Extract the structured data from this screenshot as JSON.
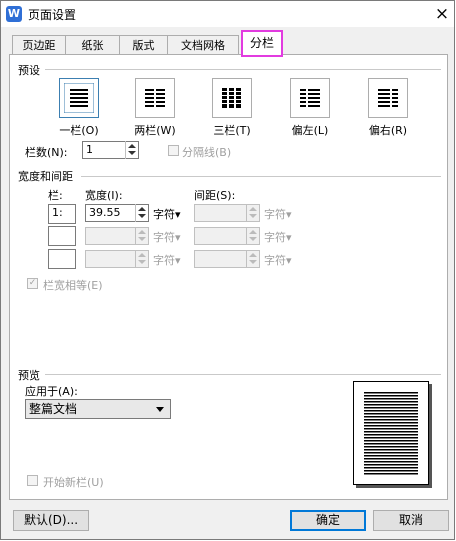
{
  "window": {
    "icon_letter": "W",
    "title": "页面设置",
    "close_symbol": "×"
  },
  "tabs": [
    {
      "label": "页边距"
    },
    {
      "label": "纸张"
    },
    {
      "label": "版式"
    },
    {
      "label": "文档网格"
    },
    {
      "label": "分栏",
      "active": true
    }
  ],
  "presets": {
    "section_label": "预设",
    "items": [
      {
        "label": "一栏(O)",
        "icon": "one-column-icon",
        "selected": true
      },
      {
        "label": "两栏(W)",
        "icon": "two-columns-icon"
      },
      {
        "label": "三栏(T)",
        "icon": "three-columns-icon"
      },
      {
        "label": "偏左(L)",
        "icon": "left-column-icon"
      },
      {
        "label": "偏右(R)",
        "icon": "right-column-icon"
      }
    ]
  },
  "column_count": {
    "label": "栏数(N):",
    "value": "1"
  },
  "divider_line": {
    "label": "分隔线(B)",
    "checked": false,
    "enabled": false
  },
  "width_spacing": {
    "section_label": "宽度和间距",
    "col_header": "栏:",
    "width_header": "宽度(I):",
    "spacing_header": "间距(S):",
    "rows": [
      {
        "col": "1:",
        "width": "39.55",
        "width_unit": "字符",
        "spacing": "",
        "spacing_unit": "字符"
      },
      {
        "col": "",
        "width": "",
        "width_unit": "字符",
        "spacing": "",
        "spacing_unit": "字符"
      },
      {
        "col": "",
        "width": "",
        "width_unit": "字符",
        "spacing": "",
        "spacing_unit": "字符"
      }
    ]
  },
  "equal_width": {
    "label": "栏宽相等(E)",
    "checked": true,
    "enabled": false
  },
  "preview": {
    "section_label": "预览",
    "apply_label": "应用于(A):",
    "apply_value": "整篇文档"
  },
  "new_column": {
    "label": "开始新栏(U)",
    "checked": false,
    "enabled": false
  },
  "buttons": {
    "default": "默认(D)...",
    "ok": "确定",
    "cancel": "取消"
  },
  "colors": {
    "active_tab_border": "#e23be0",
    "accent": "#0078d7"
  }
}
